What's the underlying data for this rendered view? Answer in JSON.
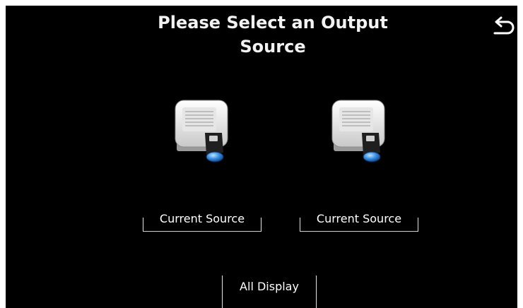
{
  "header": {
    "title_line1": "Please Select an Output",
    "title_line2": "Source",
    "back_icon": "back-arrow-icon"
  },
  "outputs": [
    {
      "icon": "projector-icon",
      "label": "Current Source"
    },
    {
      "icon": "projector-icon",
      "label": "Current Source"
    }
  ],
  "all_display": {
    "label": "All Display"
  },
  "colors": {
    "background": "#000000",
    "text": "#ffffff",
    "lens": "#3a8fe0"
  }
}
